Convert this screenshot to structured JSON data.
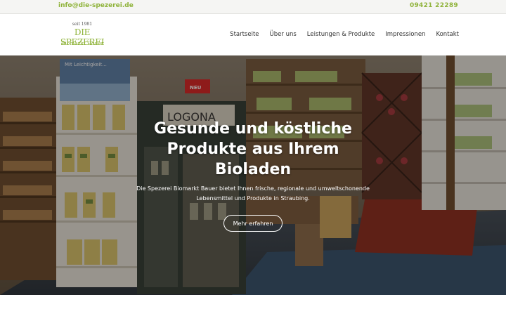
{
  "topbar": {
    "email": "info@die-spezerei.de",
    "phone": "09421 22289"
  },
  "logo": {
    "since": "seit 1981",
    "name": "DIE SPEZEREI",
    "sub": "Biomarkt",
    "script": "Bauer"
  },
  "nav": {
    "items": [
      {
        "label": "Startseite"
      },
      {
        "label": "Über uns"
      },
      {
        "label": "Leistungen & Produkte"
      },
      {
        "label": "Impressionen"
      },
      {
        "label": "Kontakt"
      }
    ]
  },
  "hero": {
    "headline": "Gesunde und köstliche Produkte aus Ihrem Bioladen",
    "text": "Die Spezerei Biomarkt Bauer bietet Ihnen frische, regionale und umweltschonende Lebensmittel und Produkte in Straubing.",
    "cta_label": "Mehr erfahren",
    "photo_labels": {
      "poster": "Mit Leichtigkeit...",
      "brand_sign": "LOGONA",
      "new_badge": "NEU"
    }
  },
  "colors": {
    "accent": "#8fb33a",
    "overlay": "#14100c"
  }
}
